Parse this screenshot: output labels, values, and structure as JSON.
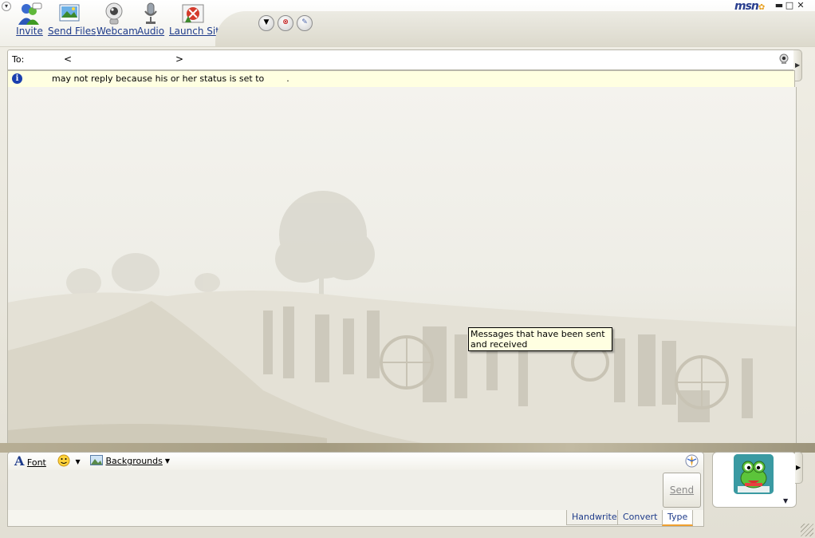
{
  "toolbar": {
    "items": [
      {
        "label": "Invite",
        "icon": "invite-icon"
      },
      {
        "label": "Send Files",
        "icon": "send-files-icon"
      },
      {
        "label": "Webcam",
        "icon": "webcam-icon"
      },
      {
        "label": "Audio",
        "icon": "audio-icon"
      },
      {
        "label": "Launch Site",
        "icon": "launch-site-icon"
      }
    ],
    "round_buttons": [
      "dropdown-icon",
      "block-icon",
      "paint-icon"
    ]
  },
  "brand": {
    "logo_text": "msn"
  },
  "window_controls": {
    "minimize": "▬",
    "maximize": "□",
    "close": "✕"
  },
  "to_bar": {
    "label": "To:",
    "open_bracket": "<",
    "close_bracket": ">"
  },
  "info_bar": {
    "text": "may not reply because his or her status is set to        ."
  },
  "tooltip": {
    "text": "Messages that have been sent and received"
  },
  "format_bar": {
    "font_label": "Font",
    "backgrounds_label": "Backgrounds"
  },
  "send": {
    "label": "Send"
  },
  "tabs": [
    {
      "label": "Handwrite",
      "active": false
    },
    {
      "label": "Convert",
      "active": false
    },
    {
      "label": "Type",
      "active": true
    }
  ],
  "colors": {
    "link": "#1e3b8a",
    "info_bg": "#ffffe1",
    "accent": "#f0a030"
  }
}
